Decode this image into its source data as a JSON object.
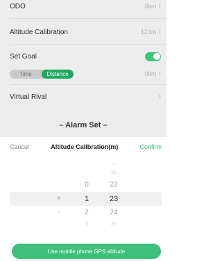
{
  "settings": {
    "odo": {
      "label": "ODO",
      "value": "0km"
    },
    "altitude_calibration": {
      "label": "Altitude Calibration",
      "value": "123m"
    },
    "set_goal": {
      "label": "Set Goal",
      "enabled": true
    },
    "goal_mode": {
      "options": [
        "Time",
        "Distance"
      ],
      "selected": "Distance",
      "value": "0km"
    },
    "virtual_rival": {
      "label": "Virtual Rival"
    },
    "alarm_set_header": "– Alarm Set –"
  },
  "picker": {
    "cancel_label": "Cancel",
    "title": "Altitude Calibration(m)",
    "confirm_label": "Confirm",
    "sign_column": {
      "prev": "-",
      "selected": "+",
      "next": "-"
    },
    "hundreds_column": {
      "prev": "0",
      "selected": "1",
      "next": "2",
      "next2": "3"
    },
    "tens_column": {
      "prev3": "—",
      "prev2": "21",
      "prev": "22",
      "selected": "23",
      "next": "24",
      "next2": "25"
    },
    "gps_button_label": "Use mobile phone GPS altitude"
  },
  "colors": {
    "accent_green": "#3cc07a",
    "segment_green": "#1fa862",
    "confirm_green": "#2fbf72",
    "dimmed_background": "#ececec"
  },
  "icons": [
    "chevron-right-icon",
    "toggle-switch-icon"
  ]
}
